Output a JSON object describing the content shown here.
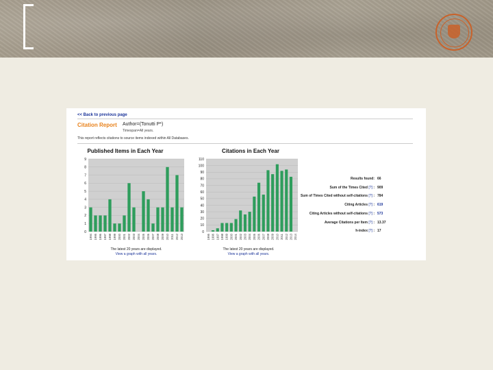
{
  "nav": {
    "back_label": "<< Back to previous page"
  },
  "report": {
    "title": "Citation Report",
    "author": "Author=(Tonutti P*)",
    "timespan": "Timespan=All years.",
    "note": "This report reflects citations to source items indexed within All Databases."
  },
  "chart_data": [
    {
      "type": "bar",
      "title": "Published Items in Each Year",
      "categories": [
        "1994",
        "1995",
        "1996",
        "1997",
        "1998",
        "1999",
        "2000",
        "2001",
        "2002",
        "2003",
        "2004",
        "2005",
        "2006",
        "2007",
        "2008",
        "2009",
        "2010",
        "2011",
        "2012",
        "2013"
      ],
      "values": [
        3,
        2,
        2,
        2,
        4,
        1,
        1,
        2,
        6,
        3,
        0,
        5,
        4,
        1,
        3,
        3,
        8,
        3,
        7,
        3
      ],
      "ylim": [
        0,
        9
      ],
      "yticks": [
        "0",
        "1",
        "2",
        "3",
        "4",
        "5",
        "6",
        "7",
        "8",
        "9"
      ],
      "bar_color": "#2e9d5c",
      "grid": true,
      "footnote": "The latest 20 years are displayed.",
      "link": "View a graph with all years."
    },
    {
      "type": "bar",
      "title": "Citations in Each Year",
      "categories": [
        "1995",
        "1996",
        "1997",
        "1998",
        "1999",
        "2000",
        "2001",
        "2002",
        "2003",
        "2004",
        "2005",
        "2006",
        "2007",
        "2008",
        "2009",
        "2010",
        "2011",
        "2012",
        "2013",
        "2014"
      ],
      "values": [
        0,
        2,
        5,
        13,
        13,
        13,
        19,
        32,
        26,
        30,
        53,
        74,
        56,
        93,
        87,
        102,
        92,
        94,
        83,
        0
      ],
      "ylim": [
        0,
        110
      ],
      "yticks": [
        "0",
        "10",
        "20",
        "30",
        "40",
        "50",
        "60",
        "70",
        "80",
        "90",
        "100",
        "110"
      ],
      "bar_color": "#2e9d5c",
      "grid": true,
      "footnote": "The latest 20 years are displayed.",
      "link": "View a graph with all years."
    }
  ],
  "stats": {
    "q": "[?]",
    "rows": [
      {
        "label": "Results found:",
        "has_q": false,
        "value": "66",
        "link": false
      },
      {
        "label": "Sum of the Times Cited",
        "has_q": true,
        "value": "909",
        "link": false
      },
      {
        "label": "Sum of Times Cited without self-citations",
        "has_q": true,
        "value": "784",
        "link": false
      },
      {
        "label": "Citing Articles",
        "has_q": true,
        "value": "619",
        "link": true
      },
      {
        "label": "Citing Articles without self-citations",
        "has_q": true,
        "value": "573",
        "link": true
      },
      {
        "label": "Average Citations per Item",
        "has_q": true,
        "value": "13.37",
        "link": false
      },
      {
        "label": "h-index",
        "has_q": true,
        "value": "17",
        "link": false
      }
    ]
  }
}
